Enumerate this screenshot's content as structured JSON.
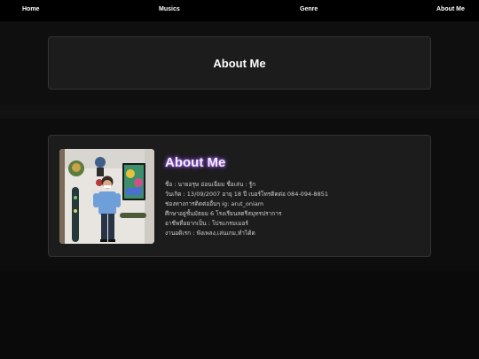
{
  "nav": {
    "home": "Home",
    "musics": "Musics",
    "genre": "Genre",
    "about": "About Me"
  },
  "hero": {
    "title": "About Me"
  },
  "about": {
    "title": "About Me",
    "lines": [
      "ชื่อ : นายอรุษ อ่อนเฉี่ยม ชื่อเล่น : รู้ก",
      "วันเกิด : 13/09/2007 อายุ 18 ปี เบอร์โทรติดต่อ 084-094-8851",
      "ช่องทางการติดต่ออื่นๆ ig: arut_oniam",
      "ศึกษาอยู่ชั้นมัธยม 6 โรงเรียนสตรีสมุทรปราการ",
      "อาชีพที่อยากเป็น : โปรแกรมเมอร์",
      "งานอดิเรก : ฟังเพลง,เล่นเกม,ทำได้ด"
    ]
  },
  "colors": {
    "page_background": "#0b0b0b",
    "card_background": "#1c1c1c",
    "title_glow": "#9a4dff"
  }
}
